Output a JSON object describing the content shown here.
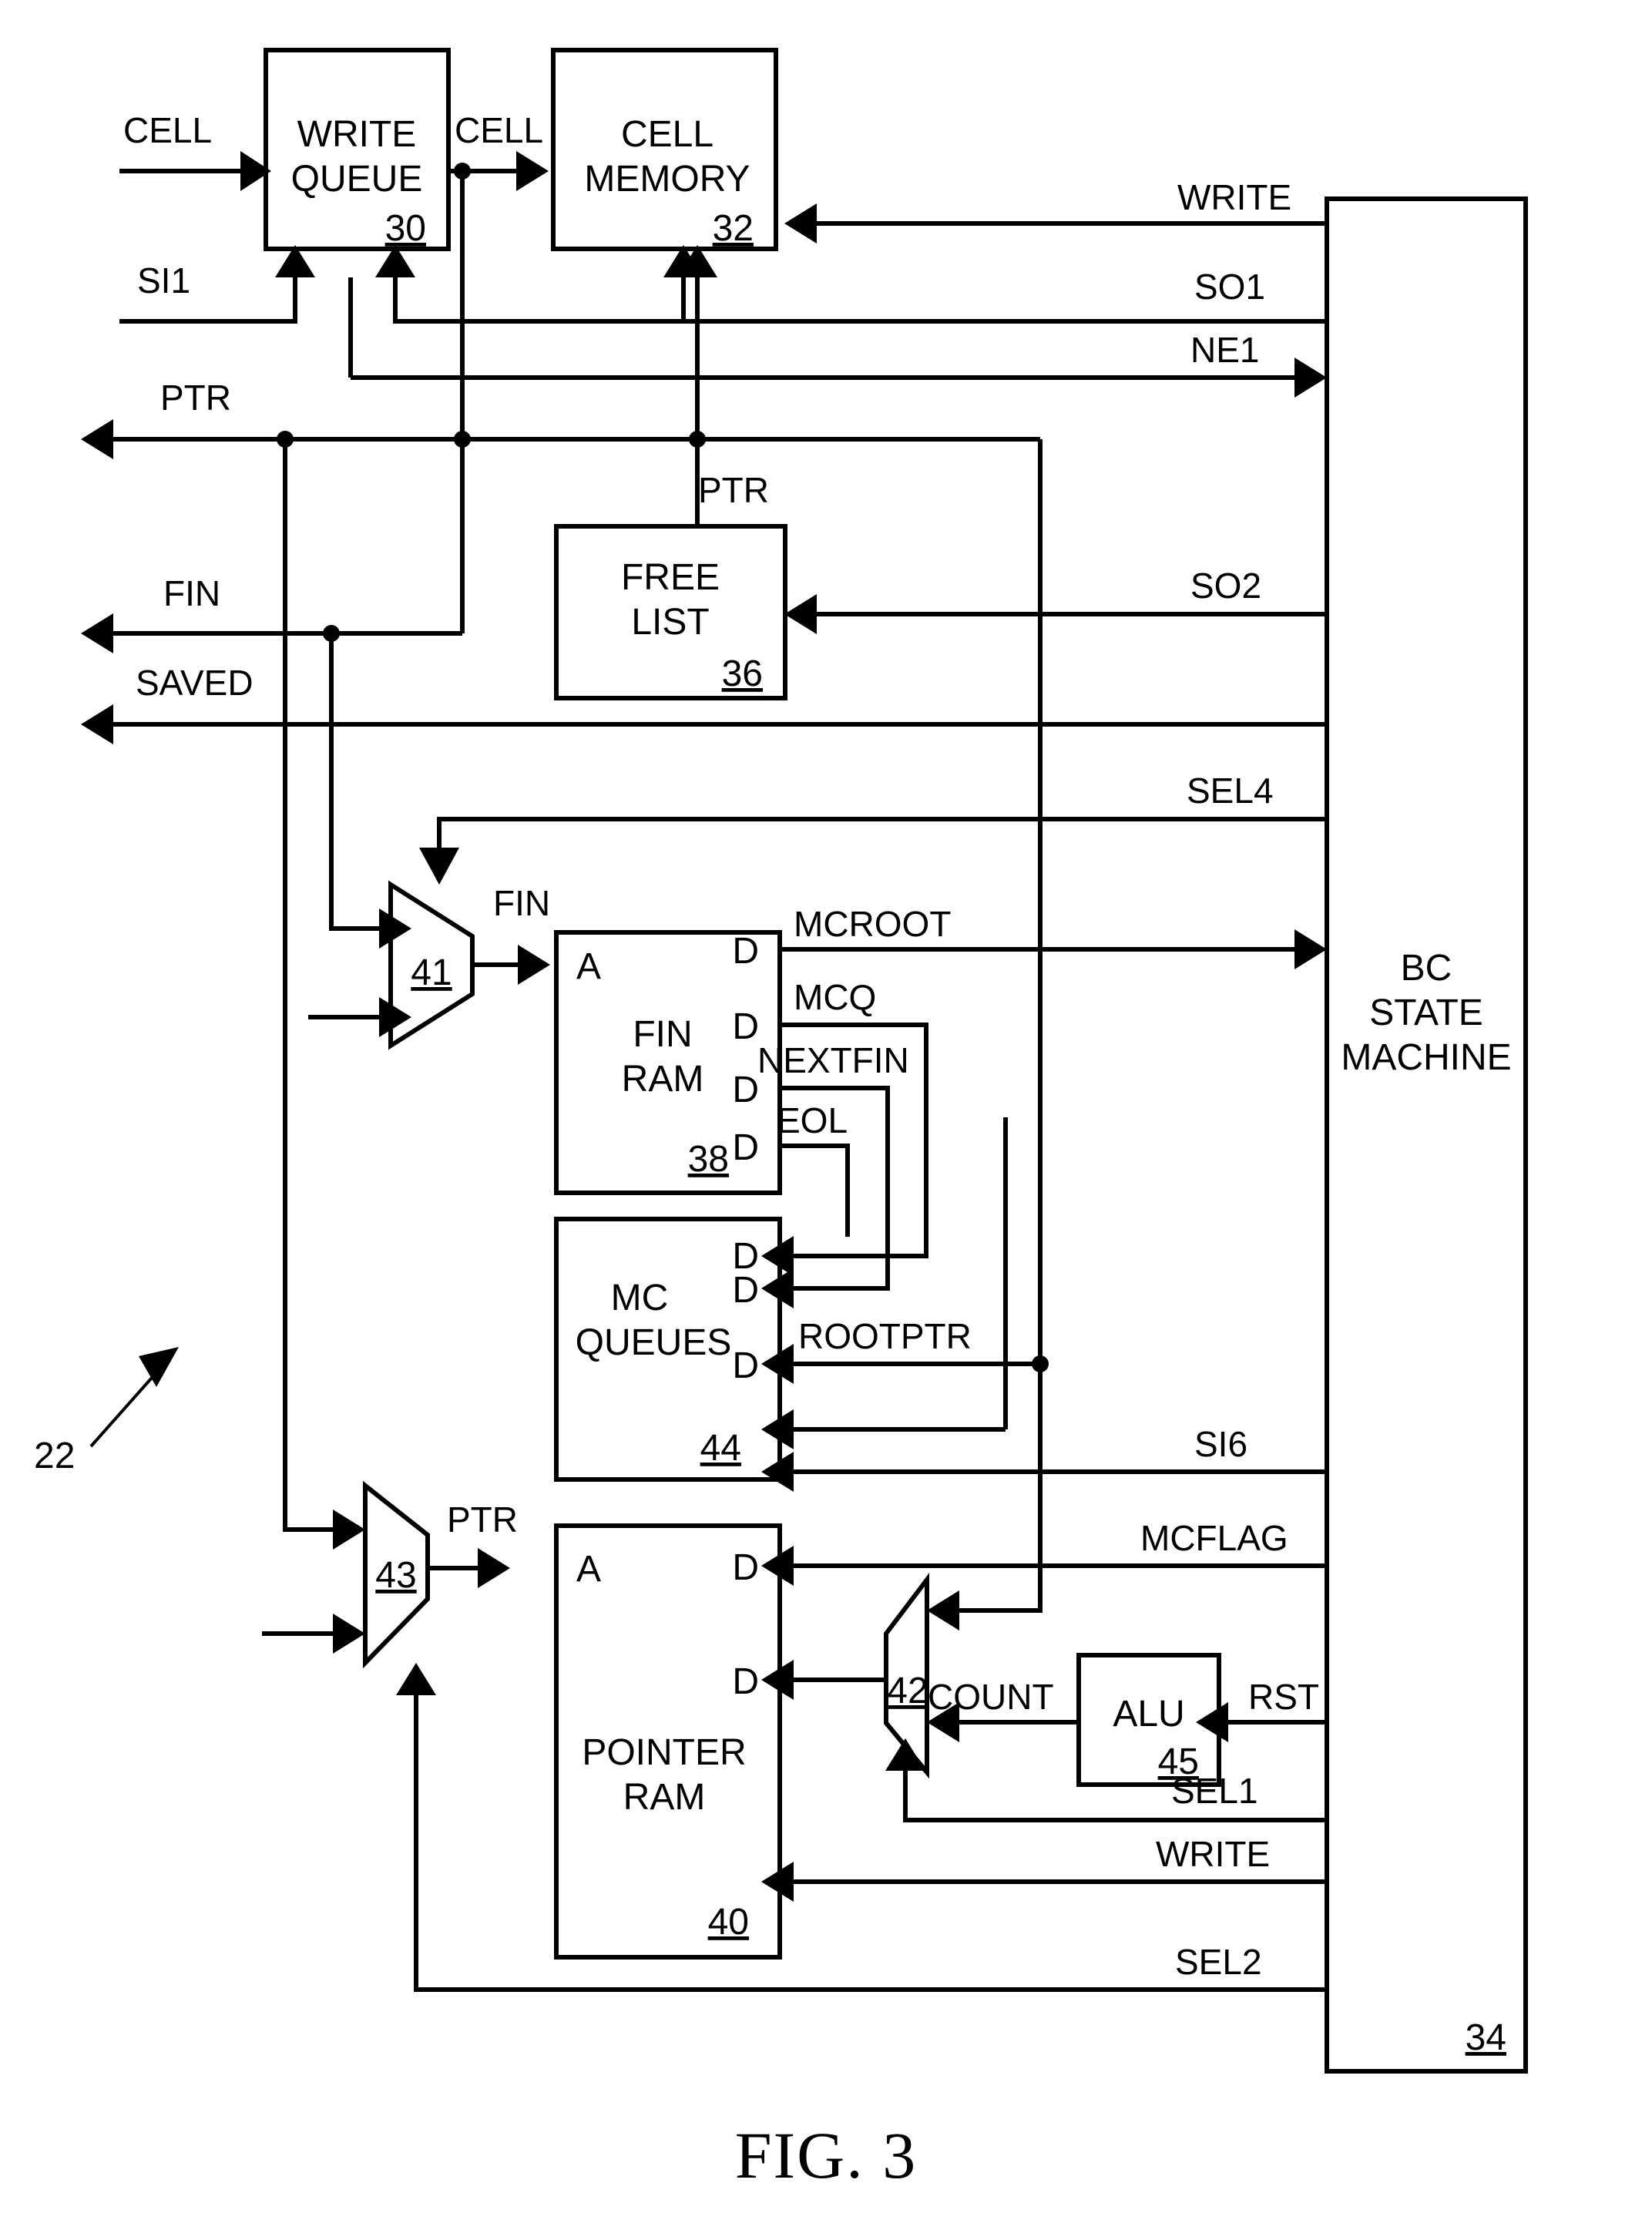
{
  "figure": {
    "caption": "FIG. 3",
    "system_ref": "22"
  },
  "blocks": [
    {
      "id": "write_queue",
      "lines": [
        "WRITE",
        "QUEUE"
      ],
      "ref": "30"
    },
    {
      "id": "cell_memory",
      "lines": [
        "CELL",
        "MEMORY"
      ],
      "ref": "32"
    },
    {
      "id": "free_list",
      "lines": [
        "FREE",
        "LIST"
      ],
      "ref": "36"
    },
    {
      "id": "fin_ram",
      "lines": [
        "FIN",
        "RAM"
      ],
      "ref": "38"
    },
    {
      "id": "mc_queues",
      "lines": [
        "MC",
        "QUEUES"
      ],
      "ref": "44"
    },
    {
      "id": "pointer_ram",
      "lines": [
        "POINTER",
        "RAM"
      ],
      "ref": "40"
    },
    {
      "id": "alu",
      "lines": [
        "ALU"
      ],
      "ref": "45"
    },
    {
      "id": "bc_state",
      "lines": [
        "BC",
        "STATE",
        "MACHINE"
      ],
      "ref": "34"
    }
  ],
  "muxes": [
    {
      "id": "mux41",
      "ref": "41",
      "out_label": "FIN"
    },
    {
      "id": "mux43",
      "ref": "43",
      "out_label": "PTR"
    },
    {
      "id": "mux42",
      "ref": "42",
      "out_label": "COUNT"
    }
  ],
  "signals": {
    "cell_in": "CELL",
    "cell_mid": "CELL",
    "si1": "SI1",
    "ptr_out": "PTR",
    "ptr_freelist": "PTR",
    "fin_out": "FIN",
    "saved_out": "SAVED",
    "write_top": "WRITE",
    "so1": "SO1",
    "ne1": "NE1",
    "so2": "SO2",
    "sel4": "SEL4",
    "mcroot": "MCROOT",
    "mcq": "MCQ",
    "nextfin": "NEXTFIN",
    "eol": "EOL",
    "rootptr": "ROOTPTR",
    "si6": "SI6",
    "mcflag": "MCFLAG",
    "count": "COUNT",
    "rst": "RST",
    "sel1": "SEL1",
    "write_bottom": "WRITE",
    "sel2": "SEL2"
  },
  "pins": {
    "address": "A",
    "data": "D"
  }
}
